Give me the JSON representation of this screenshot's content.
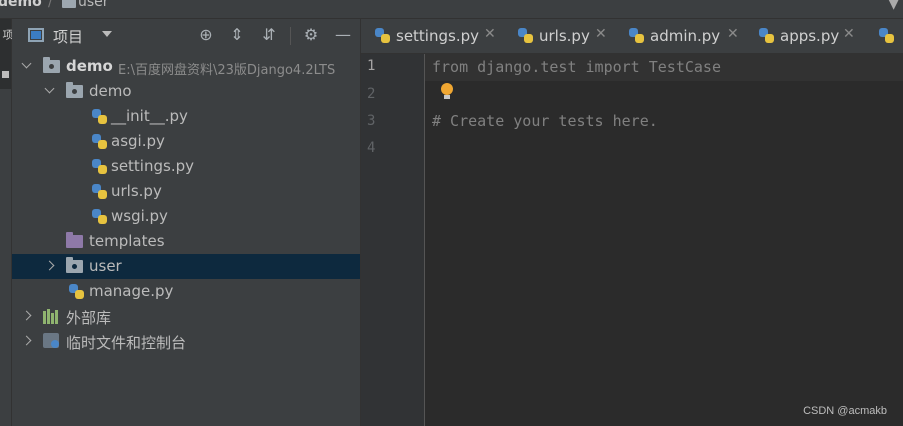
{
  "breadcrumb": {
    "project": "demo",
    "separator": "/",
    "folder": "user"
  },
  "left_strip": {
    "tab_label": "项"
  },
  "project_panel": {
    "title": "项目",
    "toolbar_icons": [
      "locate-icon",
      "expand-all-icon",
      "collapse-all-icon",
      "gear-icon",
      "minimize-icon"
    ]
  },
  "tree": {
    "root": {
      "name": "demo",
      "path": "E:\\百度网盘资料\\23版Django4.2LTS"
    },
    "demo_folder": "demo",
    "files": [
      "__init__.py",
      "asgi.py",
      "settings.py",
      "urls.py",
      "wsgi.py"
    ],
    "templates": "templates",
    "user": "user",
    "manage": "manage.py",
    "external_libs": "外部库",
    "scratches": "临时文件和控制台"
  },
  "tabs": [
    {
      "label": "settings.py"
    },
    {
      "label": "urls.py"
    },
    {
      "label": "admin.py"
    },
    {
      "label": "apps.py"
    }
  ],
  "editor": {
    "line_numbers": [
      "1",
      "2",
      "3",
      "4"
    ],
    "lines": [
      "from django.test import TestCase",
      "",
      "# Create your tests here.",
      ""
    ]
  },
  "watermark": "CSDN @acmakb"
}
